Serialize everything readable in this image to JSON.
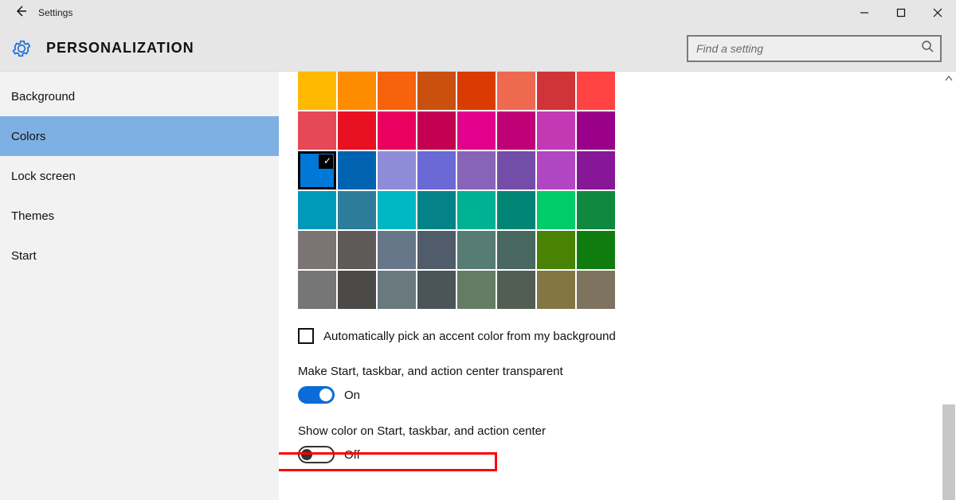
{
  "titlebar": {
    "back_icon": "←",
    "title": "Settings"
  },
  "header": {
    "section": "PERSONALIZATION",
    "search_placeholder": "Find a setting"
  },
  "sidebar": {
    "items": [
      {
        "label": "Background",
        "selected": false
      },
      {
        "label": "Colors",
        "selected": true
      },
      {
        "label": "Lock screen",
        "selected": false
      },
      {
        "label": "Themes",
        "selected": false
      },
      {
        "label": "Start",
        "selected": false
      }
    ]
  },
  "colors": {
    "swatches": [
      [
        "#ffb900",
        "#ff8c00",
        "#f7630c",
        "#ca5010",
        "#da3b01",
        "#ef6950",
        "#d13438",
        "#ff4343"
      ],
      [
        "#e74856",
        "#e81123",
        "#ea005e",
        "#c30052",
        "#e3008c",
        "#bf0077",
        "#c239b3",
        "#9a0089"
      ],
      [
        "#0078d7",
        "#0063b1",
        "#8e8cd8",
        "#6b69d6",
        "#8764b8",
        "#744da9",
        "#b146c2",
        "#881798"
      ],
      [
        "#0099bc",
        "#2d7d9a",
        "#00b7c3",
        "#038387",
        "#00b294",
        "#018574",
        "#00cc6a",
        "#10893e"
      ],
      [
        "#7a7574",
        "#5d5a58",
        "#68768a",
        "#515c6b",
        "#567c73",
        "#486860",
        "#498205",
        "#107c10"
      ],
      [
        "#767676",
        "#4c4a48",
        "#69797e",
        "#4a5459",
        "#647c64",
        "#525e54",
        "#847545",
        "#7e735f"
      ]
    ],
    "selected_index": [
      2,
      0
    ],
    "auto_pick_label": "Automatically pick an accent color from my background",
    "auto_pick_checked": false
  },
  "settings": {
    "transparent": {
      "label": "Make Start, taskbar, and action center transparent",
      "state": "On",
      "on": true
    },
    "show_color": {
      "label": "Show color on Start, taskbar, and action center",
      "state": "Off",
      "on": false
    }
  }
}
